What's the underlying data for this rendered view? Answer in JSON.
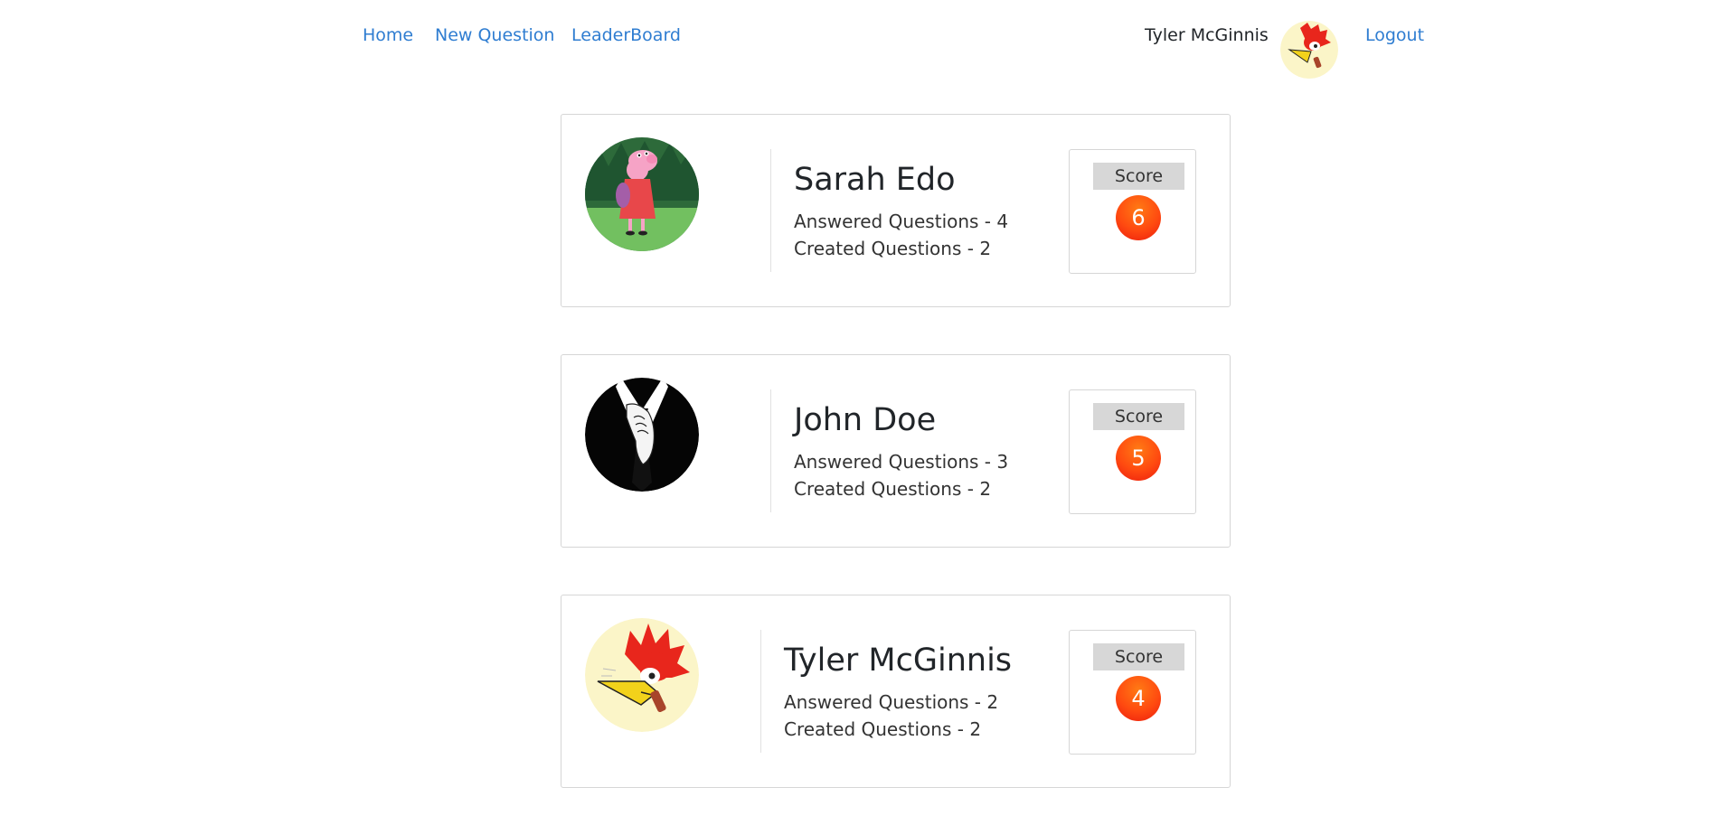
{
  "nav": {
    "home": "Home",
    "new_question": "New Question",
    "leaderboard": "LeaderBoard",
    "username": "Tyler McGinnis",
    "logout": "Logout",
    "link_color": "#2f7dd1"
  },
  "leaderboard": [
    {
      "name": "Sarah Edo",
      "answered": "Answered Questions - 4",
      "created": "Created Questions - 2",
      "score_label": "Score",
      "score": "6",
      "avatar": "peppa-pig-avatar"
    },
    {
      "name": "John Doe",
      "answered": "Answered Questions - 3",
      "created": "Created Questions - 2",
      "score_label": "Score",
      "score": "5",
      "avatar": "suit-and-tie-avatar"
    },
    {
      "name": "Tyler McGinnis",
      "answered": "Answered Questions - 2",
      "created": "Created Questions - 2",
      "score_label": "Score",
      "score": "4",
      "avatar": "woodpecker-avatar"
    }
  ],
  "colors": {
    "score_badge": "#ff4a10",
    "score_label_bg": "#d7d7d7",
    "border": "#d6d6d6"
  }
}
